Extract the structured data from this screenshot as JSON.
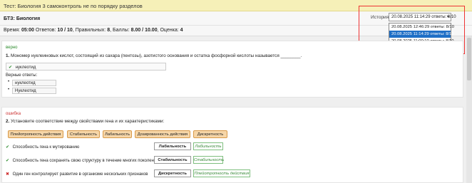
{
  "header": {
    "title": "Тест: Биология 3 самоконтроль не по порядку разделов"
  },
  "info": {
    "bts_label": "БТЗ:",
    "bts_value": "Биология",
    "time_label": "Время:",
    "time_value": "05:00",
    "answers_label": "Ответов:",
    "answers_value": "10 / 10",
    "correct_label": "Правильных:",
    "correct_value": "8",
    "score_label": "Баллы:",
    "score_value": "8.00 / 10.00",
    "grade_label": "Оценка:",
    "grade_value": "4"
  },
  "history": {
    "label": "История:",
    "selected": "20.08.2025 11:14:29 ответы: 8/10",
    "options": [
      "20.08.2025 12:46:29 ответы: 8/10",
      "20.08.2025 11:14:29 ответы: 8/10",
      "20.08.2025 11:00:10 ответы: 8/10"
    ]
  },
  "q1": {
    "status": "верно",
    "number": "1.",
    "text": "Мономер нуклеиновых кислот, состоящий из сахара (пентозы), азотистого основания и остатка фосфорной кислоты называется ________.",
    "user_answer": "нуклеотид",
    "correct_label": "Верные ответы:",
    "correct_answers": [
      "нуклеотид",
      "Нуклеотид"
    ]
  },
  "q2": {
    "status": "ошибка",
    "number": "2.",
    "text": "Установите соответствие между свойствами гена и их характеристиками:",
    "options": [
      "Плейотропность действия",
      "Стабильность",
      "Лабильность",
      "Дозированность действия",
      "Дискретность"
    ],
    "rows": [
      {
        "mark": "✔",
        "text": "Способность гена к мутированию",
        "user": "Лабильность",
        "correct": "Лабильность"
      },
      {
        "mark": "✔",
        "text": "Способность гена сохранять свою структуру в течение многих поколений",
        "user": "Стабильность",
        "correct": "Стабильность"
      },
      {
        "mark": "✖",
        "text": "Один ген контролирует развитие в организме нескольких признаков",
        "user": "Дискретность",
        "correct": "Плейотропность действия"
      }
    ]
  },
  "colors": {
    "header_bg": "#f6f0b8",
    "tag_bg": "#f6d6a8",
    "ok": "#2a8a2a",
    "err": "#cc3333",
    "highlight": "#1f6fc6"
  }
}
